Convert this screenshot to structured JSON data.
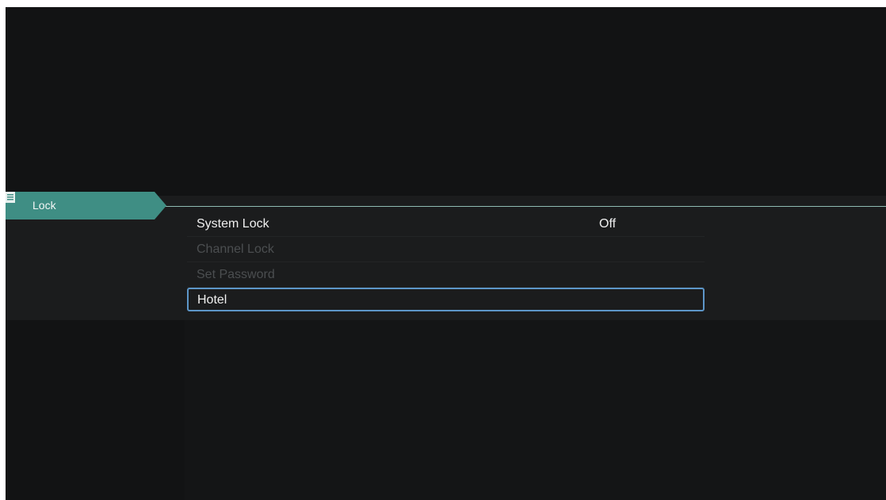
{
  "tab": {
    "label": "Lock",
    "icon": "list-icon",
    "color": "#3f8e84"
  },
  "menu": {
    "items": [
      {
        "label": "System Lock",
        "value": "Off",
        "enabled": true,
        "focused": false
      },
      {
        "label": "Channel Lock",
        "value": "",
        "enabled": false,
        "focused": false
      },
      {
        "label": "Set Password",
        "value": "",
        "enabled": false,
        "focused": false
      },
      {
        "label": "Hotel",
        "value": "",
        "enabled": true,
        "focused": true
      }
    ]
  },
  "colors": {
    "background": "#121314",
    "focus_border": "#5d96c8",
    "accent": "#3f8e84"
  }
}
